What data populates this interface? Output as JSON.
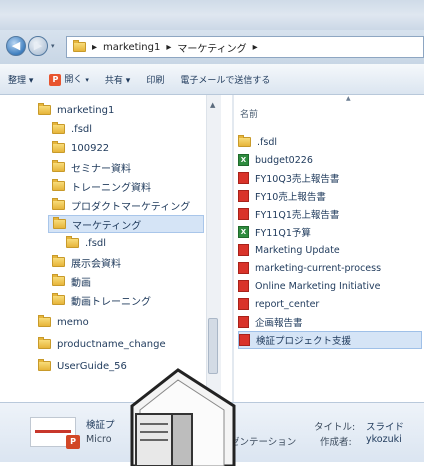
{
  "address": {
    "segments": [
      "marketing1",
      "マーケティング"
    ]
  },
  "toolbar": {
    "organize": "整理 ▾",
    "open": "開く",
    "share": "共有 ▾",
    "print": "印刷",
    "email": "電子メールで送信する"
  },
  "nav": {
    "items": [
      {
        "label": "marketing1"
      },
      {
        "label": ".fsdl"
      },
      {
        "label": "100922"
      },
      {
        "label": "セミナー資料"
      },
      {
        "label": "トレーニング資料"
      },
      {
        "label": "プロダクトマーケティング"
      },
      {
        "label": "マーケティング"
      },
      {
        "label": ".fsdl"
      },
      {
        "label": "展示会資料"
      },
      {
        "label": "動画"
      },
      {
        "label": "動画トレーニング"
      },
      {
        "label": "memo"
      },
      {
        "label": "productname_change"
      },
      {
        "label": "UserGuide_56"
      }
    ]
  },
  "files": {
    "column_header": "名前",
    "items": [
      {
        "name": ".fsdl",
        "icon": "folder-icon"
      },
      {
        "name": "budget0226",
        "icon": "excel-file-icon"
      },
      {
        "name": "FY10Q3売上報告書",
        "icon": "pdf-file-icon"
      },
      {
        "name": "FY10売上報告書",
        "icon": "pdf-file-icon"
      },
      {
        "name": "FY11Q1売上報告書",
        "icon": "pdf-file-icon"
      },
      {
        "name": "FY11Q1予算",
        "icon": "excel-file-icon"
      },
      {
        "name": "Marketing Update",
        "icon": "pdf-file-icon"
      },
      {
        "name": "marketing-current-process",
        "icon": "pdf-file-icon"
      },
      {
        "name": "Online Marketing Initiative",
        "icon": "pdf-file-icon"
      },
      {
        "name": "report_center",
        "icon": "pdf-file-icon"
      },
      {
        "name": "企画報告書",
        "icon": "pdf-file-icon"
      },
      {
        "name": "検証プロジェクト支援",
        "icon": "pdf-file-icon"
      }
    ]
  },
  "details": {
    "name": "検証プ",
    "type_prefix": "Micro",
    "type_suffix": "ゼンテーション",
    "title_label": "タイトル:",
    "title_value": "スライド",
    "author_label": "作成者:",
    "author_value": "ykozuki"
  },
  "colors": {
    "selection": "#d5e4f6",
    "chrome": "#dbe5f0",
    "text": "#1e395b"
  }
}
